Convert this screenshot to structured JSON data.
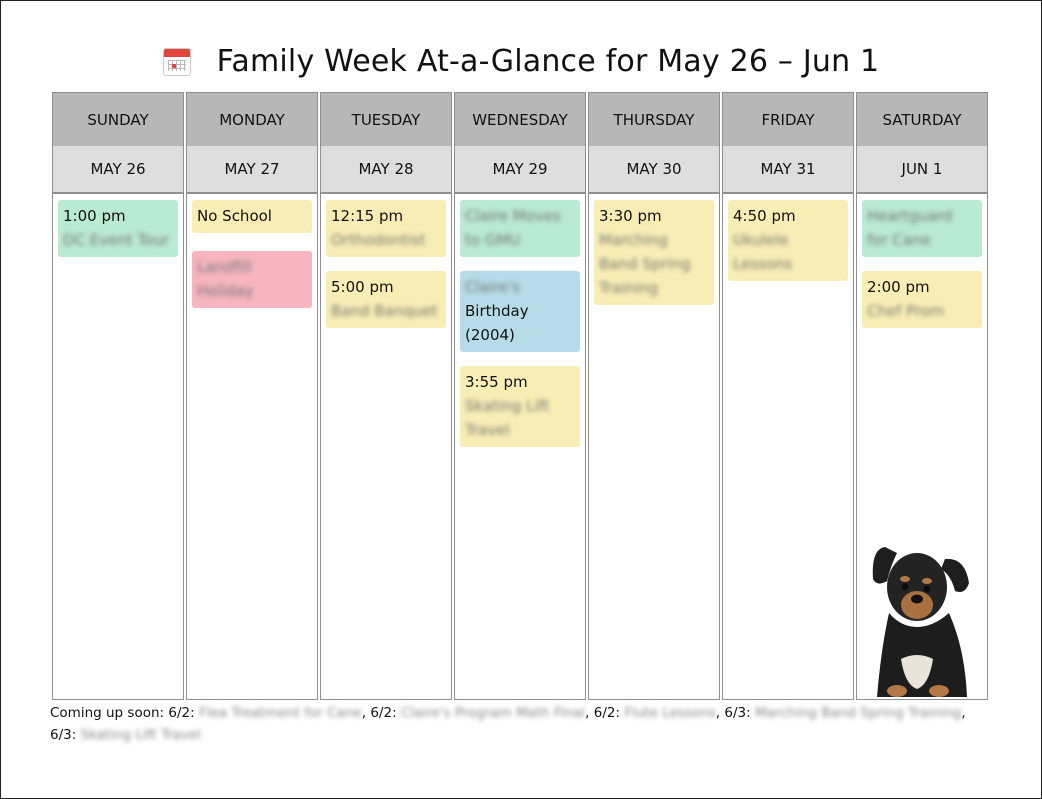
{
  "title": "Family Week At-a-Glance for May 26 – Jun 1",
  "days": [
    {
      "day": "SUNDAY",
      "date": "MAY 26",
      "events": [
        {
          "time": "1:00 pm",
          "desc": "DC Event Tour",
          "color": "green"
        }
      ]
    },
    {
      "day": "MONDAY",
      "date": "MAY 27",
      "events": [
        {
          "time": "No School",
          "desc": "",
          "color": "yellow"
        },
        {
          "time": "",
          "desc": "Landfill Holiday",
          "color": "red"
        }
      ]
    },
    {
      "day": "TUESDAY",
      "date": "MAY 28",
      "events": [
        {
          "time": "12:15 pm",
          "desc": "Orthodontist",
          "color": "yellow"
        },
        {
          "time": "5:00 pm",
          "desc": "Band Banquet",
          "color": "yellow"
        }
      ]
    },
    {
      "day": "WEDNESDAY",
      "date": "MAY 29",
      "events": [
        {
          "time": "",
          "desc": "Claire Moves to GMU",
          "color": "green"
        },
        {
          "time": "",
          "desc": "Claire's",
          "desc2": "Birthday (2004)",
          "color": "blue"
        },
        {
          "time": "3:55 pm",
          "desc": "Skating Lift Travel",
          "color": "yellow"
        }
      ]
    },
    {
      "day": "THURSDAY",
      "date": "MAY 30",
      "events": [
        {
          "time": "3:30 pm",
          "desc": "Marching Band Spring Training",
          "color": "yellow"
        }
      ]
    },
    {
      "day": "FRIDAY",
      "date": "MAY 31",
      "events": [
        {
          "time": "4:50 pm",
          "desc": "Ukulele Lessons",
          "color": "yellow"
        }
      ]
    },
    {
      "day": "SATURDAY",
      "date": "JUN 1",
      "events": [
        {
          "time": "",
          "desc": "Heartguard for Cane",
          "color": "green"
        },
        {
          "time": "2:00 pm",
          "desc": "Chef Prom",
          "color": "yellow"
        }
      ]
    }
  ],
  "footer": {
    "prefix": "Coming up soon:",
    "items": [
      {
        "date": "6/2:",
        "desc": "Flea Treatment for Cane"
      },
      {
        "date": "6/2:",
        "desc": "Claire's Program Math Final"
      },
      {
        "date": "6/2:",
        "desc": "Flute Lessons"
      },
      {
        "date": "6/3:",
        "desc": "Marching Band Spring Training"
      },
      {
        "date": "6/3:",
        "desc": "Skating Lift Travel"
      }
    ]
  },
  "colors": {
    "green": "#b9ead2",
    "yellow": "#f8eeb5",
    "red": "#f6b5bf",
    "blue": "#b5dce8",
    "header": "#b7b7b7",
    "subheader": "#dedede"
  },
  "icons": [
    "calendar-icon",
    "dog-photo"
  ]
}
